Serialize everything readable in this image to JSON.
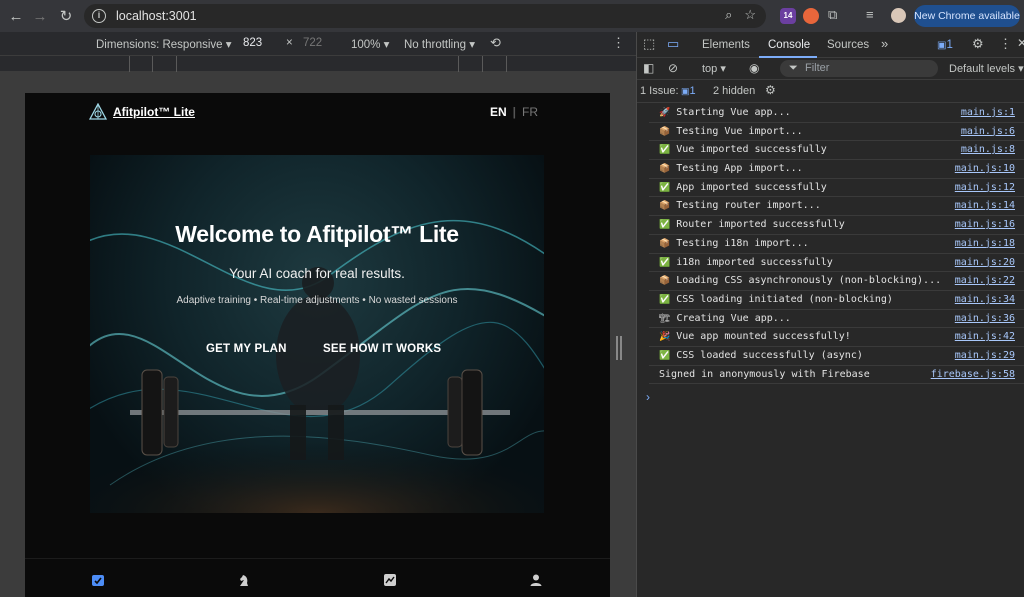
{
  "browser": {
    "url": "localhost:3001",
    "ext_badge": "14",
    "update_button": "New Chrome available"
  },
  "device_toolbar": {
    "dimensions_label": "Dimensions: Responsive",
    "width": "823",
    "times": "×",
    "height": "722",
    "zoom": "100%",
    "throttling": "No throttling"
  },
  "page": {
    "brand": "Afitpilot™ Lite",
    "lang_en": "EN",
    "lang_sep": "|",
    "lang_fr": "FR",
    "hero_title": "Welcome to Afitpilot™ Lite",
    "hero_subtitle": "Your AI coach for real results.",
    "hero_features": "Adaptive training • Real-time adjustments • No wasted sessions",
    "cta_primary": "GET MY PLAN",
    "cta_secondary": "SEE HOW IT WORKS"
  },
  "devtools": {
    "tabs": [
      "Elements",
      "Console",
      "Sources"
    ],
    "more_tabs": "»",
    "issue_count": "1",
    "context": "top",
    "filter_placeholder": "Filter",
    "levels": "Default levels",
    "issues_label": "1 Issue:",
    "issues_badge": "1",
    "hidden": "2 hidden",
    "logs": [
      {
        "icon": "rocket",
        "glyph": "🚀",
        "msg": "Starting Vue app...",
        "src": "main.js:1"
      },
      {
        "icon": "package",
        "glyph": "📦",
        "msg": "Testing Vue import...",
        "src": "main.js:6"
      },
      {
        "icon": "check",
        "glyph": "✅",
        "msg": "Vue imported successfully",
        "src": "main.js:8"
      },
      {
        "icon": "package",
        "glyph": "📦",
        "msg": "Testing App import...",
        "src": "main.js:10"
      },
      {
        "icon": "check",
        "glyph": "✅",
        "msg": "App imported successfully",
        "src": "main.js:12"
      },
      {
        "icon": "package",
        "glyph": "📦",
        "msg": "Testing router import...",
        "src": "main.js:14"
      },
      {
        "icon": "check",
        "glyph": "✅",
        "msg": "Router imported successfully",
        "src": "main.js:16"
      },
      {
        "icon": "package",
        "glyph": "📦",
        "msg": "Testing i18n import...",
        "src": "main.js:18"
      },
      {
        "icon": "check",
        "glyph": "✅",
        "msg": "i18n imported successfully",
        "src": "main.js:20"
      },
      {
        "icon": "package",
        "glyph": "📦",
        "msg": "Loading CSS asynchronously (non-blocking)...",
        "src": "main.js:22"
      },
      {
        "icon": "check",
        "glyph": "✅",
        "msg": "CSS loading initiated (non-blocking)",
        "src": "main.js:34"
      },
      {
        "icon": "construction",
        "glyph": "🏗",
        "msg": "Creating Vue app...",
        "src": "main.js:36"
      },
      {
        "icon": "party",
        "glyph": "🎉",
        "msg": "Vue app mounted successfully!",
        "src": "main.js:42"
      },
      {
        "icon": "check",
        "glyph": "✅",
        "msg": "CSS loaded successfully (async)",
        "src": "main.js:29"
      },
      {
        "icon": "none",
        "glyph": "",
        "msg": "Signed in anonymously with Firebase",
        "src": "firebase.js:58"
      }
    ],
    "prompt": "›"
  }
}
